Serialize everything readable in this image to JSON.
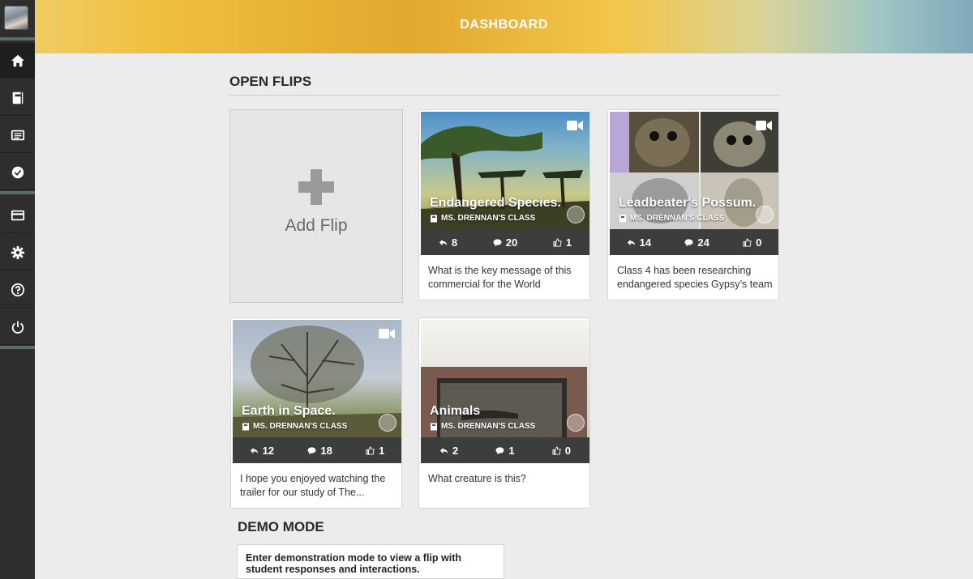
{
  "header": {
    "title": "DASHBOARD"
  },
  "sidebar": {
    "items": [
      {
        "icon": "home-icon"
      },
      {
        "icon": "notebook-icon"
      },
      {
        "icon": "list-icon"
      },
      {
        "icon": "check-circle-icon"
      },
      {
        "icon": "card-icon"
      },
      {
        "icon": "gear-icon"
      },
      {
        "icon": "help-icon"
      },
      {
        "icon": "power-icon"
      }
    ]
  },
  "open_flips": {
    "title": "OPEN FLIPS",
    "add_label": "Add Flip",
    "cards": [
      {
        "title": "Endangered Species.",
        "class": "MS. DRENNAN'S CLASS",
        "replies": "8",
        "comments": "20",
        "likes": "1",
        "desc": "What is the key message of this commercial for the World"
      },
      {
        "title": "Leadbeater's Possum.",
        "class": "MS. DRENNAN'S CLASS",
        "replies": "14",
        "comments": "24",
        "likes": "0",
        "desc": "Class 4 has been researching endangered species Gypsy’s team"
      },
      {
        "title": "Earth in Space.",
        "class": "MS. DRENNAN'S CLASS",
        "replies": "12",
        "comments": "18",
        "likes": "1",
        "desc": "I hope you enjoyed watching the trailer for our study of The..."
      },
      {
        "title": "Animals",
        "class": "MS. DRENNAN'S CLASS",
        "replies": "2",
        "comments": "1",
        "likes": "0",
        "desc": "What creature is this?"
      }
    ]
  },
  "demo": {
    "title": "DEMO MODE",
    "text": "Enter demonstration mode to view a flip with student responses and interactions."
  }
}
